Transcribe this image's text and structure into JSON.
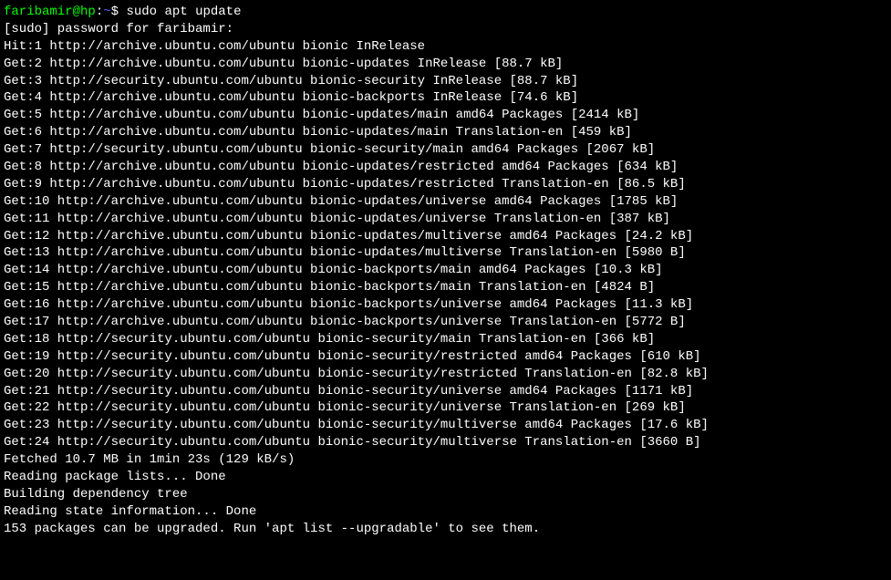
{
  "prompt": {
    "user_host": "faribamir@hp",
    "colon": ":",
    "path": "~",
    "dollar": "$ ",
    "command": "sudo apt update"
  },
  "lines": [
    "[sudo] password for faribamir:",
    "Hit:1 http://archive.ubuntu.com/ubuntu bionic InRelease",
    "Get:2 http://archive.ubuntu.com/ubuntu bionic-updates InRelease [88.7 kB]",
    "Get:3 http://security.ubuntu.com/ubuntu bionic-security InRelease [88.7 kB]",
    "Get:4 http://archive.ubuntu.com/ubuntu bionic-backports InRelease [74.6 kB]",
    "Get:5 http://archive.ubuntu.com/ubuntu bionic-updates/main amd64 Packages [2414 kB]",
    "Get:6 http://archive.ubuntu.com/ubuntu bionic-updates/main Translation-en [459 kB]",
    "Get:7 http://security.ubuntu.com/ubuntu bionic-security/main amd64 Packages [2067 kB]",
    "Get:8 http://archive.ubuntu.com/ubuntu bionic-updates/restricted amd64 Packages [634 kB]",
    "Get:9 http://archive.ubuntu.com/ubuntu bionic-updates/restricted Translation-en [86.5 kB]",
    "Get:10 http://archive.ubuntu.com/ubuntu bionic-updates/universe amd64 Packages [1785 kB]",
    "Get:11 http://archive.ubuntu.com/ubuntu bionic-updates/universe Translation-en [387 kB]",
    "Get:12 http://archive.ubuntu.com/ubuntu bionic-updates/multiverse amd64 Packages [24.2 kB]",
    "Get:13 http://archive.ubuntu.com/ubuntu bionic-updates/multiverse Translation-en [5980 B]",
    "Get:14 http://archive.ubuntu.com/ubuntu bionic-backports/main amd64 Packages [10.3 kB]",
    "Get:15 http://archive.ubuntu.com/ubuntu bionic-backports/main Translation-en [4824 B]",
    "Get:16 http://archive.ubuntu.com/ubuntu bionic-backports/universe amd64 Packages [11.3 kB]",
    "Get:17 http://archive.ubuntu.com/ubuntu bionic-backports/universe Translation-en [5772 B]",
    "Get:18 http://security.ubuntu.com/ubuntu bionic-security/main Translation-en [366 kB]",
    "Get:19 http://security.ubuntu.com/ubuntu bionic-security/restricted amd64 Packages [610 kB]",
    "Get:20 http://security.ubuntu.com/ubuntu bionic-security/restricted Translation-en [82.8 kB]",
    "Get:21 http://security.ubuntu.com/ubuntu bionic-security/universe amd64 Packages [1171 kB]",
    "Get:22 http://security.ubuntu.com/ubuntu bionic-security/universe Translation-en [269 kB]",
    "Get:23 http://security.ubuntu.com/ubuntu bionic-security/multiverse amd64 Packages [17.6 kB]",
    "Get:24 http://security.ubuntu.com/ubuntu bionic-security/multiverse Translation-en [3660 B]",
    "Fetched 10.7 MB in 1min 23s (129 kB/s)",
    "Reading package lists... Done",
    "Building dependency tree",
    "Reading state information... Done",
    "153 packages can be upgraded. Run 'apt list --upgradable' to see them."
  ]
}
